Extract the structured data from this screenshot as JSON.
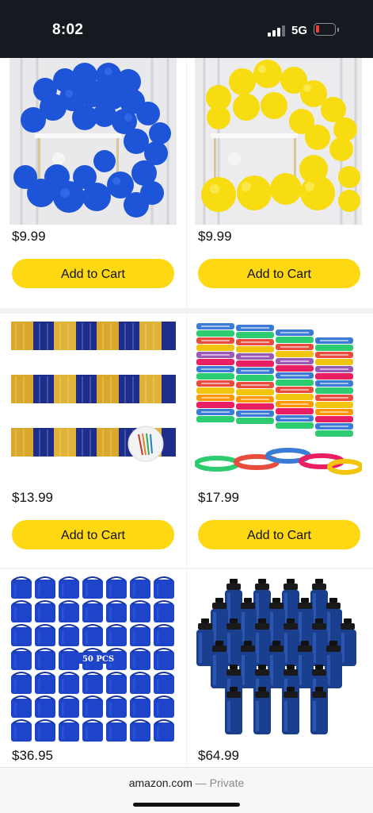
{
  "status_bar": {
    "time": "8:02",
    "network": "5G",
    "battery_level": 0.15,
    "signal_bars": 3,
    "battery_color": "#ff3b30"
  },
  "products": [
    {
      "image": "blue-balloons",
      "price": "$9.99",
      "cta": "Add to Cart"
    },
    {
      "image": "yellow-balloons",
      "price": "$9.99",
      "cta": "Add to Cart"
    },
    {
      "image": "blue-gold-fringe-banners",
      "price": "$13.99",
      "cta": "Add to Cart"
    },
    {
      "image": "running-wristbands",
      "price": "$17.99",
      "cta": "Add to Cart"
    },
    {
      "image": "blue-drawstring-bags",
      "price": "$36.95",
      "cta": "",
      "badge": "50 PCS"
    },
    {
      "image": "blue-water-bottles",
      "price": "$64.99",
      "cta": ""
    }
  ],
  "url_bar": {
    "domain": "amazon.com",
    "separator": " — ",
    "mode": "Private"
  },
  "colors": {
    "accent": "#ffd814",
    "product_blue": "#1a4fd6",
    "product_yellow": "#f7dc14"
  }
}
